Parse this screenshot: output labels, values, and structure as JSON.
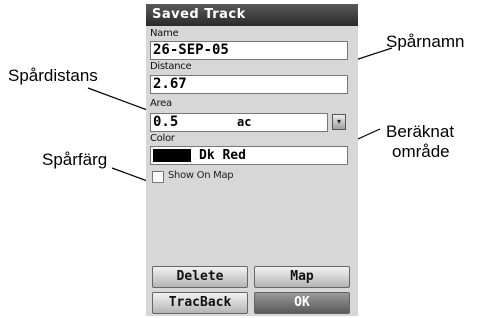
{
  "window": {
    "title": "Saved Track"
  },
  "fields": {
    "name_label": "Name",
    "name_value": "26-SEP-05",
    "distance_label": "Distance",
    "distance_value": "2.67",
    "area_label": "Area",
    "area_value": "0.5",
    "area_unit": "ac",
    "color_label": "Color",
    "color_value": "Dk Red",
    "color_swatch": "#000000"
  },
  "checkbox": {
    "label": "Show On Map",
    "checked": false
  },
  "buttons": {
    "delete": "Delete",
    "map": "Map",
    "trackback": "TracBack",
    "ok": "OK"
  },
  "callouts": {
    "track_name": "Spårnamn",
    "track_distance": "Spårdistans",
    "calculated_area_line1": "Beräknat",
    "calculated_area_line2": "område",
    "track_color": "Spårfärg"
  },
  "icons": {
    "area_dropdown": "dropdown-arrow-icon"
  }
}
